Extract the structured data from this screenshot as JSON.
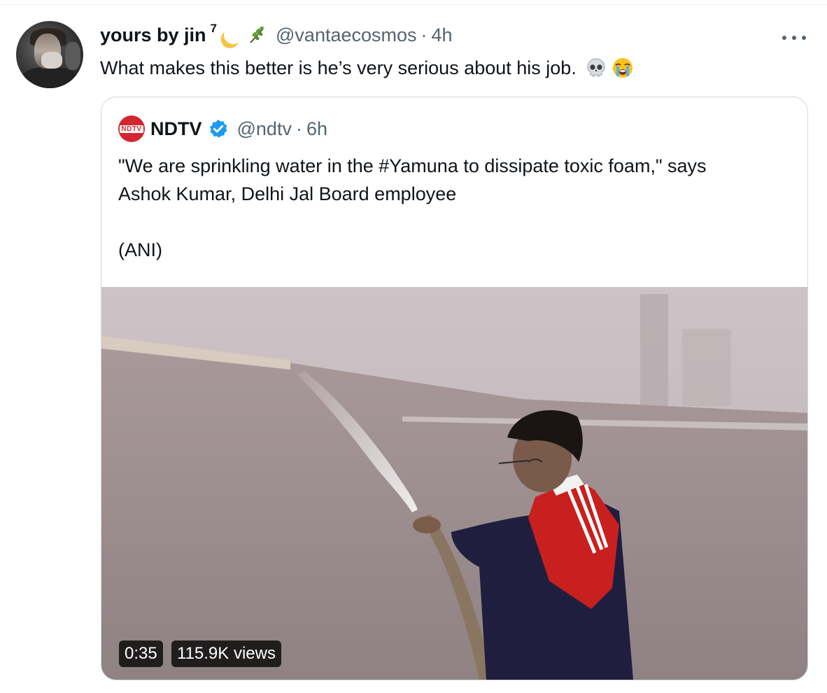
{
  "tweet": {
    "display_name": "yours by jin",
    "superscript": "7",
    "handle": "@vantaecosmos",
    "separator": "·",
    "time": "4h",
    "text": "What makes this better is he’s very serious about his job.",
    "icons": [
      "moon-icon",
      "herb-icon",
      "skull-icon",
      "crying-face-icon",
      "more-icon"
    ]
  },
  "quote": {
    "logo_text": "NDTV",
    "name": "NDTV",
    "handle": "@ndtv",
    "separator": "·",
    "time": "6h",
    "text_line1": "\"We are sprinkling water in the #Yamuna to dissipate toxic foam,\" says",
    "text_line2": "Ashok Kumar, Delhi Jal Board employee",
    "text_line3": "(ANI)",
    "verified_color": "#1d9bf0"
  },
  "video": {
    "duration": "0:35",
    "views": "115.9K views"
  },
  "colors": {
    "text": "#0f1419",
    "secondary": "#536471",
    "border": "#cfd9de",
    "ndtv_red": "#d22730"
  }
}
